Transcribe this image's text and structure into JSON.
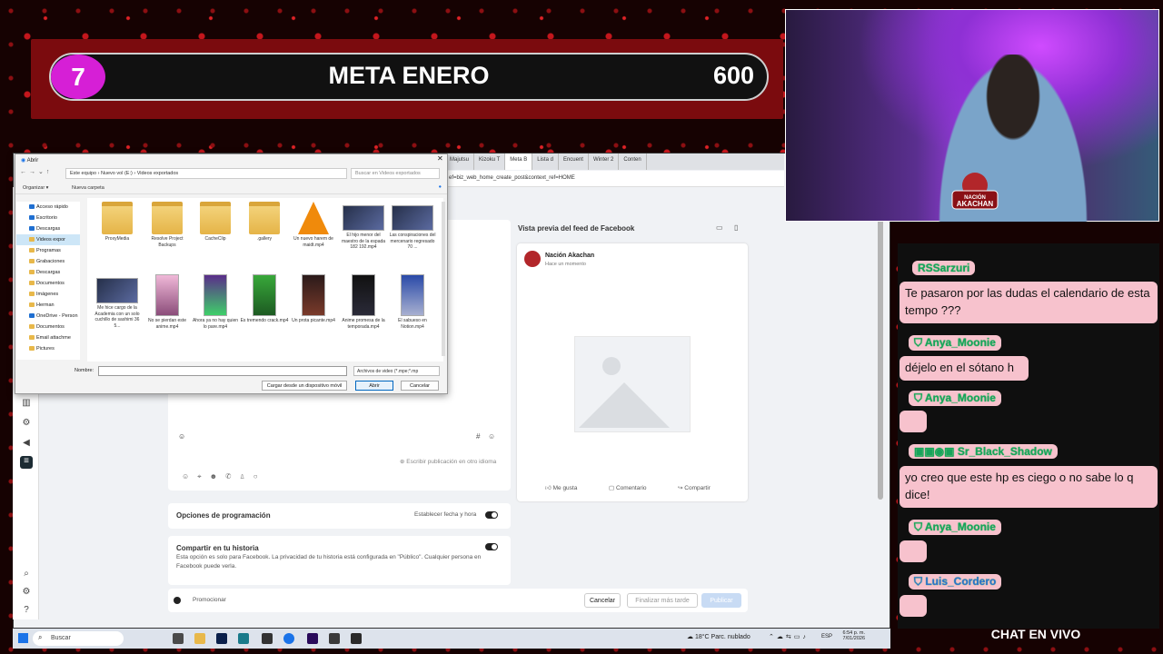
{
  "goal": {
    "current": "7",
    "title": "META ENERO",
    "target": "600"
  },
  "browser": {
    "tabs": [
      "Majutsu",
      "Kizoku T",
      "Meta B",
      "Lista d",
      "Encuent",
      "Winter 2",
      "Conten"
    ],
    "url": "ef=biz_web_home_create_post&context_ref=HOME"
  },
  "dialog": {
    "title": "Abrir",
    "breadcrumb": [
      "Este equipo",
      "Nuevo vol (E:)",
      "Videos exportados"
    ],
    "search_placeholder": "Buscar en Videos exportados",
    "toolbar": {
      "organize": "Organizar",
      "new_folder": "Nueva carpeta"
    },
    "tree": [
      {
        "label": "Acceso rápido"
      },
      {
        "label": "Escritorio"
      },
      {
        "label": "Descargas"
      },
      {
        "label": "Videos expor"
      },
      {
        "label": "Programas"
      },
      {
        "label": "Grabaciones"
      },
      {
        "label": "Descargas"
      },
      {
        "label": "Documentos"
      },
      {
        "label": "Imágenes"
      },
      {
        "label": "Herman"
      },
      {
        "label": "OneDrive - Person"
      },
      {
        "label": "Documentos"
      },
      {
        "label": "Email attachme"
      },
      {
        "label": "Pictures"
      }
    ],
    "files": [
      {
        "name": "ProxyMedia",
        "kind": "folder"
      },
      {
        "name": "Resolve Project Backups",
        "kind": "folder"
      },
      {
        "name": "CacheClip",
        "kind": "folder"
      },
      {
        "name": ".gallery",
        "kind": "folder"
      },
      {
        "name": "Un nuevo harem de maidt.mp4",
        "kind": "vlc"
      },
      {
        "name": "El hijo menor del maestro de la espada 182 192.mp4",
        "kind": "video"
      },
      {
        "name": "Las conspiraciones del mercenario regresado 70 ...",
        "kind": "video"
      },
      {
        "name": "Me hice cargo de la Academia con un solo cuchillo de sashimi 36 5...",
        "kind": "video"
      },
      {
        "name": "No se pierdan este anime.mp4",
        "kind": "tall"
      },
      {
        "name": "Ahora ya no hay quien lo pare.mp4",
        "kind": "tall"
      },
      {
        "name": "Es tremendo crack.mp4",
        "kind": "tall"
      },
      {
        "name": "Un prota picante.mp4",
        "kind": "tall"
      },
      {
        "name": "Anime promesa de la temporada.mp4",
        "kind": "tall"
      },
      {
        "name": "El sabueso en Notion.mp4",
        "kind": "tall"
      }
    ],
    "name_label": "Nombre:",
    "name_value": "",
    "file_type": "Archivos de video (*.mpe;*.mp",
    "upload_label": "Cargar desde un dispositivo móvil",
    "open_label": "Abrir",
    "cancel_label": "Cancelar"
  },
  "composer": {
    "translate_note": "Escribir publicación en otro idioma",
    "schedule": {
      "title": "Opciones de programación",
      "set_datetime": "Establecer fecha y hora"
    },
    "story": {
      "title": "Compartir en tu historia",
      "description": "Esta opción es solo para Facebook. La privacidad de tu historia está configurada en \"Público\". Cualquier persona en Facebook puede verla."
    },
    "promote_label": "Promocionar",
    "cancel": "Cancelar",
    "finish_later": "Finalizar más tarde",
    "publish": "Publicar"
  },
  "preview": {
    "heading": "Vista previa del feed de Facebook",
    "page_name": "Nación Akachan",
    "time": "Hace un momento",
    "actions": {
      "like": "Me gusta",
      "comment": "Comentario",
      "share": "Compartir"
    }
  },
  "chat": {
    "messages": [
      {
        "user": "RSSarzuri",
        "text": "Te pasaron por las dudas el calendario de esta tempo ???"
      },
      {
        "user": "Anya_Moonie",
        "text": "déjelo en el sótano h"
      },
      {
        "user": "Anya_Moonie",
        "text": ""
      },
      {
        "user": "Sr_Black_Shadow",
        "text": "yo creo que este hp es ciego o no sabe lo q dice!"
      },
      {
        "user": "Anya_Moonie",
        "text": ""
      },
      {
        "user": "Luis_Cordero",
        "text": ""
      }
    ],
    "footer": "CHAT EN VIVO"
  },
  "stream_badge": {
    "line1": "NACIÓN",
    "line2": "AKACHAN"
  },
  "taskbar": {
    "search": "Buscar",
    "weather": "18°C Parc. nublado",
    "lang": "ESP",
    "time": "6:54 p. m.",
    "date": "7/01/2026"
  },
  "colors": {
    "accent_magenta": "#d61fd6",
    "banner_red": "#7b0b0e",
    "chat_pink": "#f7c2cd",
    "chat_name_green": "#18a35b"
  }
}
